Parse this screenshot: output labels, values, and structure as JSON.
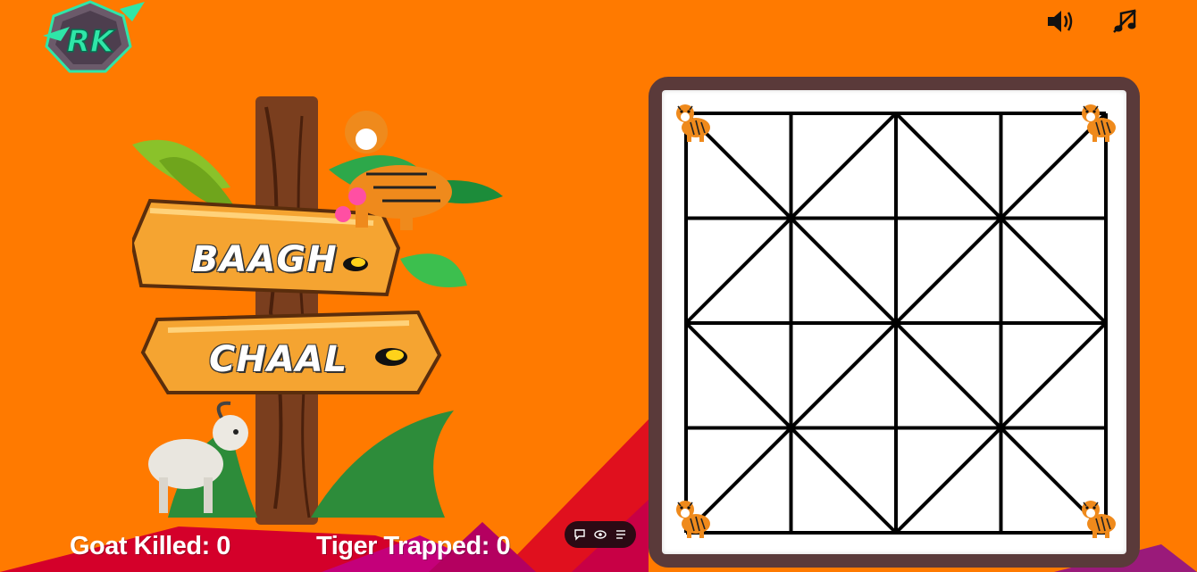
{
  "game": {
    "title_line1": "BAAGH",
    "title_line2": "CHAAL",
    "logo_text": "RK"
  },
  "controls": {
    "sound_icon": "speaker-on-icon",
    "music_icon": "music-off-icon"
  },
  "stats": {
    "goat_killed_label": "Goat Killed: 0",
    "tiger_trapped_label": "Tiger Trapped: 0"
  },
  "toolbar": {
    "items": [
      "chat-icon",
      "eye-icon",
      "menu-icon"
    ]
  },
  "board": {
    "grid_size": 5,
    "tigers": [
      "top-left",
      "top-right",
      "bottom-left",
      "bottom-right"
    ]
  },
  "colors": {
    "background": "#ff7a00",
    "board_frame": "#5a3a3a",
    "board_lines": "#000000",
    "accent_red": "#d4002a",
    "accent_magenta": "#c4007a"
  }
}
